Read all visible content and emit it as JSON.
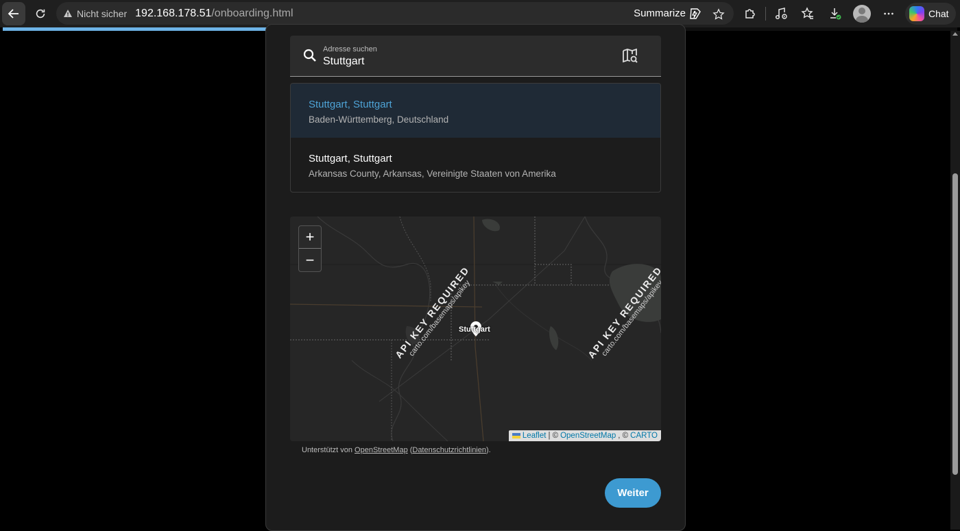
{
  "browser": {
    "security_label": "Nicht sicher",
    "url_host": "192.168.178.51",
    "url_path": "/onboarding.html",
    "summarize_label": "Summarize",
    "chat_label": "Chat"
  },
  "page_progress": 0.49,
  "search": {
    "label": "Adresse suchen",
    "value": "Stuttgart"
  },
  "results": [
    {
      "title": "Stuttgart, Stuttgart",
      "subtitle": "Baden-Württemberg, Deutschland",
      "selected": true
    },
    {
      "title": "Stuttgart, Stuttgart",
      "subtitle": "Arkansas County, Arkansas, Vereinigte Staaten von Amerika",
      "selected": false
    }
  ],
  "map": {
    "zoom_in": "+",
    "zoom_out": "−",
    "marker_label": "Stuttgart",
    "watermark_main": "API KEY REQUIRED",
    "watermark_sub": "carto.com/basemaps/apikey",
    "attribution": {
      "leaflet": "Leaflet",
      "sep1": "| ©",
      "osm": "OpenStreetMap",
      "sep2": ", ©",
      "carto": "CARTO"
    }
  },
  "powered_by": {
    "prefix": "Unterstützt von",
    "osm": "OpenStreetMap",
    "open_paren": "(",
    "privacy": "Datenschutzrichtlinien",
    "close": ")."
  },
  "actions": {
    "next_label": "Weiter"
  },
  "colors": {
    "accent": "#3d9ad1",
    "selected_text": "#4ea3d6"
  }
}
